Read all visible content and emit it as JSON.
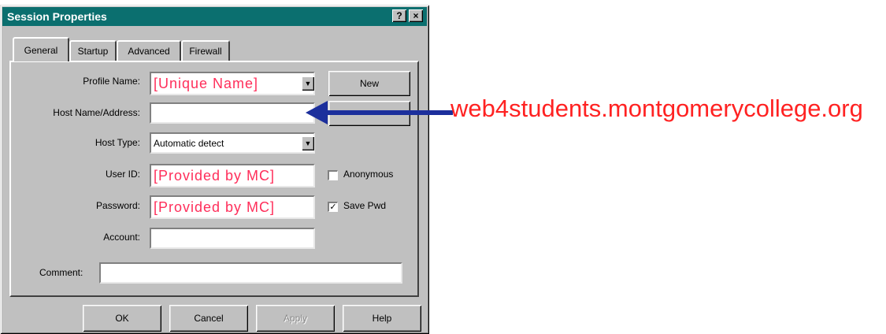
{
  "window": {
    "title": "Session Properties",
    "help_btn": "?",
    "close_btn": "×"
  },
  "tabs": [
    {
      "label": "General"
    },
    {
      "label": "Startup"
    },
    {
      "label": "Advanced"
    },
    {
      "label": "Firewall"
    }
  ],
  "form": {
    "profile_name_label": "Profile Name:",
    "profile_name_value": "[Unique Name]",
    "new_button": "New",
    "host_label": "Host Name/Address:",
    "host_value": "",
    "hidden_button": "",
    "host_type_label": "Host Type:",
    "host_type_value": "Automatic detect",
    "user_id_label": "User ID:",
    "user_id_value": "[Provided by MC]",
    "anonymous_label": "Anonymous",
    "anonymous_checked": "",
    "password_label": "Password:",
    "password_value": "[Provided by MC]",
    "save_pwd_label": "Save Pwd",
    "save_pwd_checked": "✓",
    "account_label": "Account:",
    "account_value": "",
    "comment_label": "Comment:",
    "comment_value": ""
  },
  "buttons": {
    "ok": "OK",
    "cancel": "Cancel",
    "apply": "Apply",
    "help": "Help"
  },
  "annotation": {
    "text": "web4students.montgomerycollege.org",
    "text_color": "#ff2222",
    "arrow_color": "#1c2f9c"
  },
  "colors": {
    "titlebar": "#0b6f6f",
    "red_text": "#ff2e5a"
  }
}
